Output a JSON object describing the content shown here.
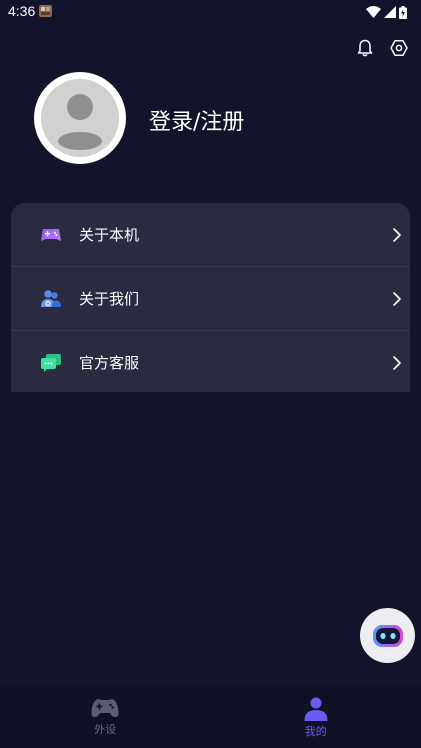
{
  "status_bar": {
    "time": "4:36"
  },
  "profile": {
    "login_label": "登录/注册"
  },
  "menu": {
    "items": [
      {
        "label": "关于本机",
        "icon": "gamepad-icon"
      },
      {
        "label": "关于我们",
        "icon": "users-icon"
      },
      {
        "label": "官方客服",
        "icon": "chat-icon"
      }
    ]
  },
  "tabs": [
    {
      "label": "外设",
      "icon": "gamepad-icon",
      "active": false
    },
    {
      "label": "我的",
      "icon": "person-icon",
      "active": true
    }
  ],
  "colors": {
    "background": "#13132b",
    "card": "#2a2a40",
    "accent": "#6a5cf0",
    "tab_inactive": "#6a6a82"
  }
}
